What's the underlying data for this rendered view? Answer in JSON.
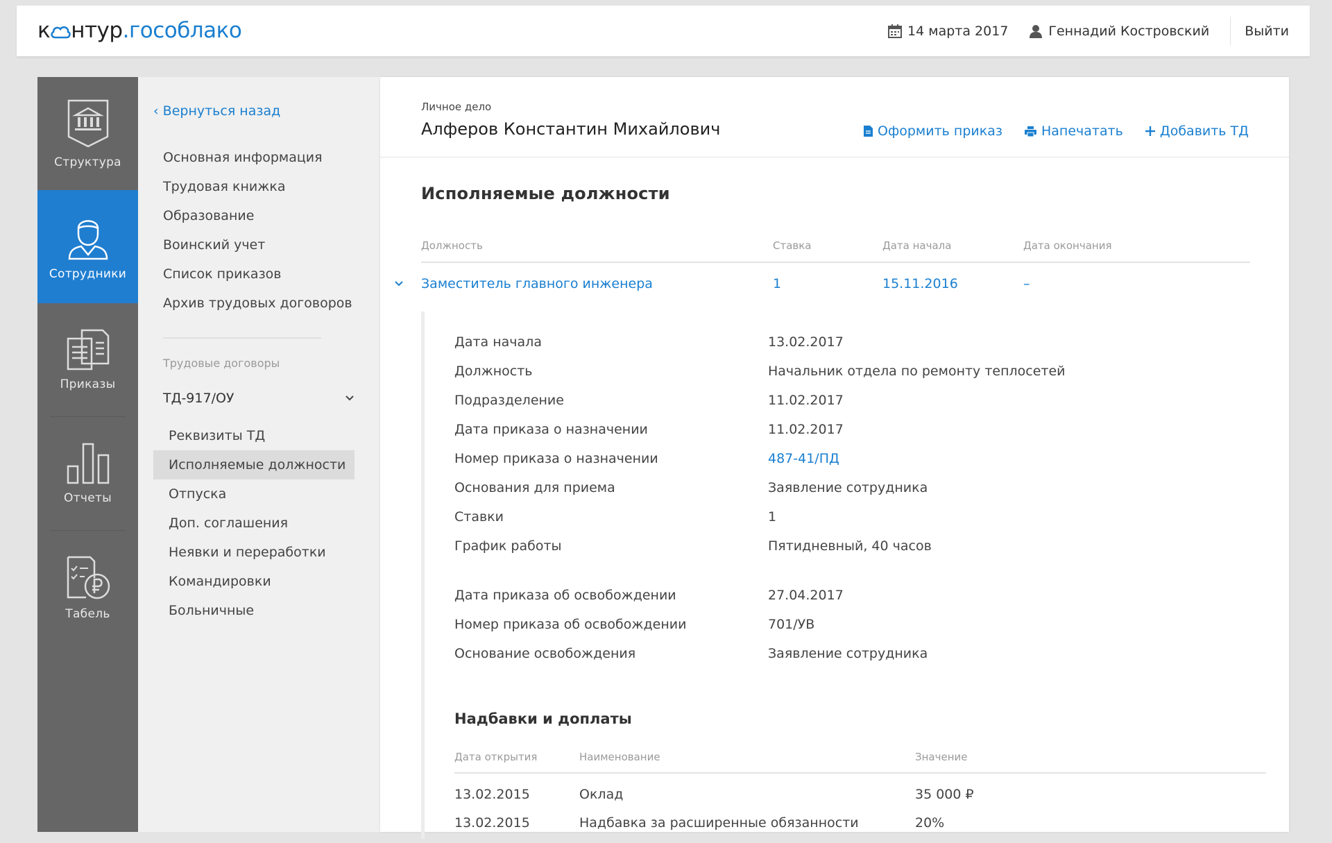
{
  "header": {
    "logo_left": "к",
    "logo_mid": "нтур",
    "logo_dot": ".",
    "logo_right": "гособлако",
    "date": "14 марта 2017",
    "user": "Геннадий Костровский",
    "logout": "Выйти"
  },
  "iconbar": {
    "items": [
      {
        "label": "Структура"
      },
      {
        "label": "Сотрудники"
      },
      {
        "label": "Приказы"
      },
      {
        "label": "Отчеты"
      },
      {
        "label": "Табель"
      }
    ]
  },
  "subnav": {
    "back": "Вернуться назад",
    "items": [
      {
        "label": "Основная информация"
      },
      {
        "label": "Трудовая книжка"
      },
      {
        "label": "Образование"
      },
      {
        "label": "Воинский учет"
      },
      {
        "label": "Список приказов"
      },
      {
        "label": "Архив трудовых договоров"
      }
    ],
    "section_title": "Трудовые договоры",
    "contract": "ТД-917/ОУ",
    "contract_items": [
      {
        "label": "Реквизиты ТД"
      },
      {
        "label": "Исполняемые должности"
      },
      {
        "label": "Отпуска"
      },
      {
        "label": "Доп. соглашения"
      },
      {
        "label": "Неявки и переработки"
      },
      {
        "label": "Командировки"
      },
      {
        "label": "Больничные"
      }
    ]
  },
  "main": {
    "subtitle": "Личное дело",
    "title": "Алферов Константин Михайлович",
    "actions": {
      "order": "Оформить приказ",
      "print": "Напечатать",
      "add": "Добавить ТД"
    },
    "section_title": "Исполняемые должности",
    "columns": {
      "position": "Должность",
      "rate": "Ставка",
      "start": "Дата начала",
      "end": "Дата окончания"
    },
    "row": {
      "position": "Заместитель главного инженера",
      "rate": "1",
      "start": "15.11.2016",
      "end": "–"
    },
    "details": [
      {
        "key": "Дата начала",
        "value": "13.02.2017"
      },
      {
        "key": "Должность",
        "value": "Начальник отдела по ремонту теплосетей"
      },
      {
        "key": "Подразделение",
        "value": "11.02.2017"
      },
      {
        "key": "Дата приказа о назначении",
        "value": "11.02.2017"
      },
      {
        "key": "Номер приказа о назначении",
        "value": "487-41/ПД"
      },
      {
        "key": "Основания для приема",
        "value": "Заявление сотрудника"
      },
      {
        "key": "Ставки",
        "value": "1"
      },
      {
        "key": "График работы",
        "value": "Пятидневный, 40 часов"
      },
      {
        "key": "Дата приказа об освобождении",
        "value": "27.04.2017"
      },
      {
        "key": "Номер приказа об освобождении",
        "value": "701/УВ"
      },
      {
        "key": "Основание освобождения",
        "value": "Заявление сотрудника"
      }
    ],
    "allowances": {
      "title": "Надбавки и доплаты",
      "columns": {
        "date": "Дата открытия",
        "name": "Наименование",
        "value": "Значение"
      },
      "rows": [
        {
          "date": "13.02.2015",
          "name": "Оклад",
          "value": "35 000 ₽"
        },
        {
          "date": "13.02.2015",
          "name": "Надбавка за расширенные обязанности",
          "value": "20%"
        }
      ]
    }
  }
}
